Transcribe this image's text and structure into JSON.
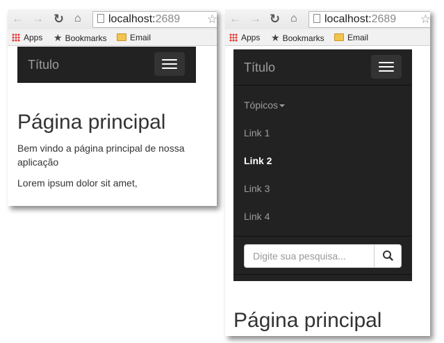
{
  "browser": {
    "url_host": "localhost:",
    "url_port": "2689",
    "bookmarks": [
      "Apps",
      "Bookmarks",
      "Email"
    ]
  },
  "navbar": {
    "brand": "Título"
  },
  "menu": {
    "dropdown": "Tópicos",
    "links": [
      "Link 1",
      "Link 2",
      "Link 3",
      "Link 4"
    ],
    "active_link": "Link 2"
  },
  "search": {
    "placeholder": "Digite sua pesquisa..."
  },
  "content": {
    "title": "Página principal",
    "welcome": "Bem vindo a página principal de nossa aplicação",
    "lorem": "Lorem ipsum dolor sit amet,"
  },
  "colors": {
    "navbar_bg": "#222222",
    "navbar_text": "#9d9d9d",
    "active_link": "#ffffff"
  }
}
